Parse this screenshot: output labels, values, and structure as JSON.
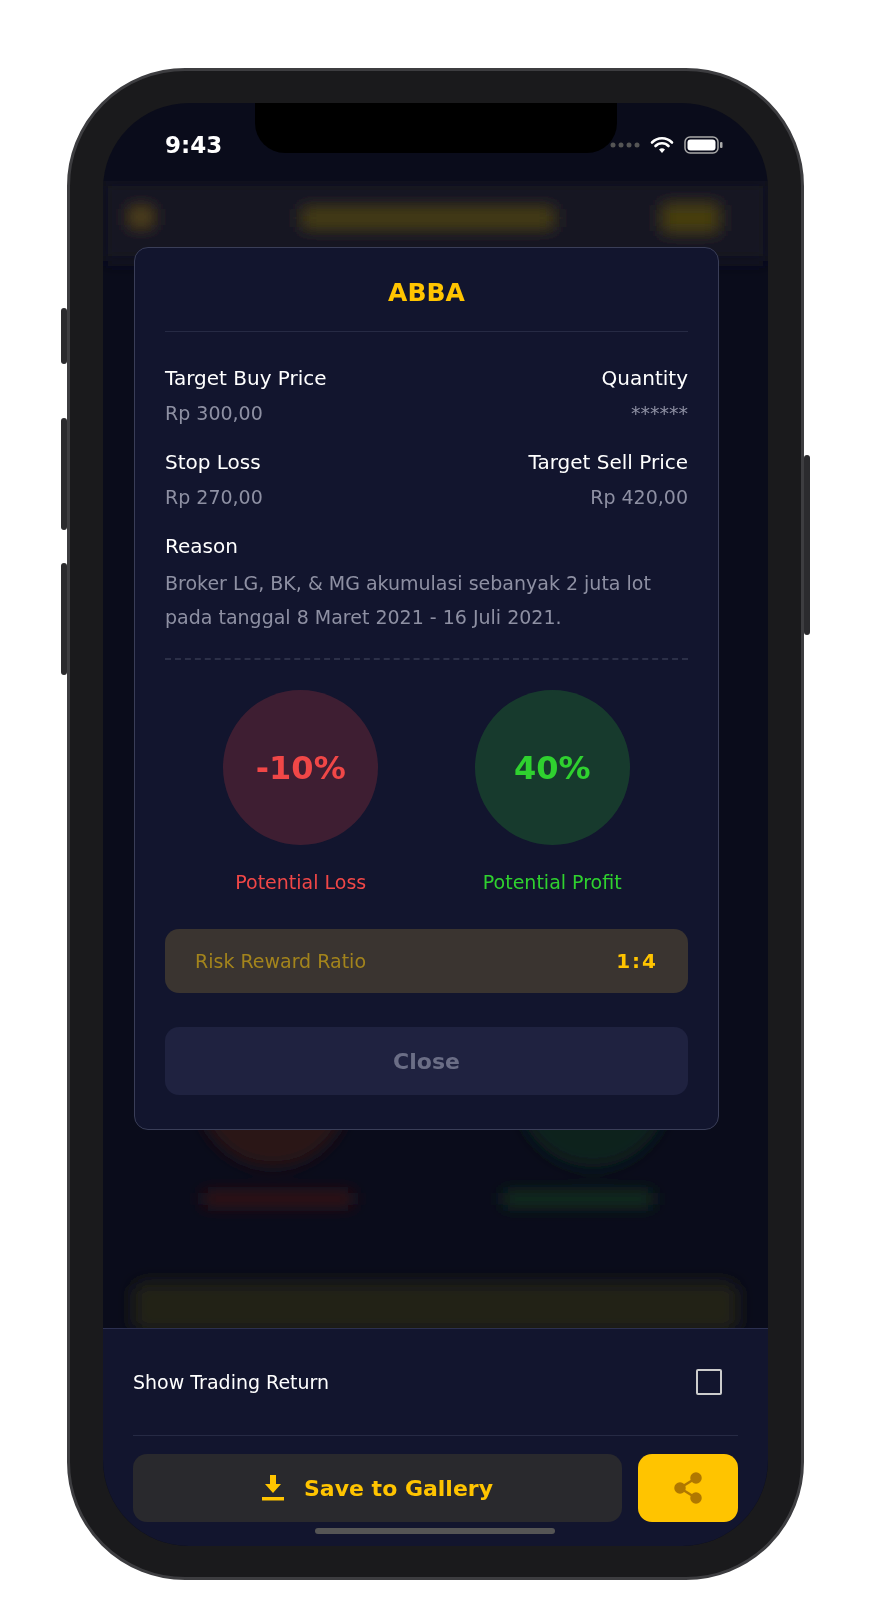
{
  "status_bar": {
    "time": "9:43"
  },
  "modal": {
    "title": "ABBA",
    "fields": [
      {
        "label": "Target Buy Price",
        "value": "Rp 300,00",
        "kind": "left"
      },
      {
        "label": "Quantity",
        "value": "******",
        "kind": "right"
      },
      {
        "label": "Stop Loss",
        "value": "Rp 270,00",
        "kind": "left"
      },
      {
        "label": "Target Sell Price",
        "value": "Rp 420,00",
        "kind": "right"
      }
    ],
    "reason": {
      "label": "Reason",
      "text": "Broker LG, BK, & MG akumulasi sebanyak 2 juta lot pada tanggal 8 Maret 2021 - 16 Juli 2021."
    },
    "potentials": [
      {
        "value": "-10%",
        "label": "Potential Loss",
        "color": "#f04747"
      },
      {
        "value": "40%",
        "label": "Potential Profit",
        "color": "#2fd12f"
      }
    ],
    "ratio": {
      "label": "Risk Reward Ratio",
      "value": "1:4"
    },
    "close_button": "Close"
  },
  "bottom_sheet": {
    "option": {
      "label": "Show Trading Return",
      "checked": false
    },
    "save_button": "Save to Gallery"
  }
}
